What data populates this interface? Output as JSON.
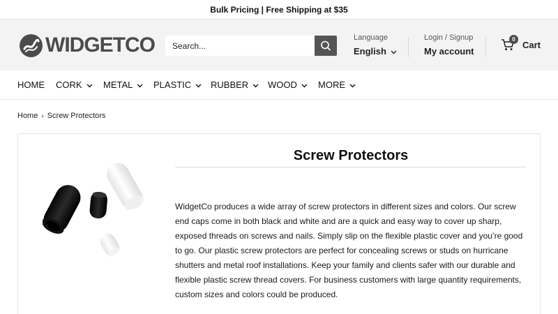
{
  "announcement": "Bulk Pricing | Free Shipping at $35",
  "logo": {
    "text": "WIDGETCO"
  },
  "search": {
    "placeholder": "Search..."
  },
  "language": {
    "label": "Language",
    "value": "English"
  },
  "account": {
    "label": "Login / Signup",
    "value": "My account"
  },
  "cart": {
    "label": "Cart",
    "count": "0"
  },
  "nav": {
    "items": [
      {
        "label": "HOME",
        "dropdown": false
      },
      {
        "label": "CORK",
        "dropdown": true
      },
      {
        "label": "METAL",
        "dropdown": true
      },
      {
        "label": "PLASTIC",
        "dropdown": true
      },
      {
        "label": "RUBBER",
        "dropdown": true
      },
      {
        "label": "WOOD",
        "dropdown": true
      },
      {
        "label": "MORE",
        "dropdown": true
      }
    ]
  },
  "breadcrumb": {
    "home": "Home",
    "current": "Screw Protectors"
  },
  "product": {
    "title": "Screw Protectors",
    "description": "WidgetCo produces a wide array of screw protectors in different sizes and colors. Our screw end caps come in both black and white and are a quick and easy way to cover up sharp, exposed threads on screws and nails. Simply slip on the flexible plastic cover and you’re good to go. Our plastic screw protectors are perfect for concealing screws or studs on hurricane shutters and metal roof installations. Keep your family and clients safer with our durable and flexible plastic screw thread covers. For business customers with large quantity requirements, custom sizes and colors could be produced."
  },
  "colors": {
    "brand": "#4b4b4b",
    "header_bg": "#f3f3f3",
    "search_button": "#555555"
  }
}
